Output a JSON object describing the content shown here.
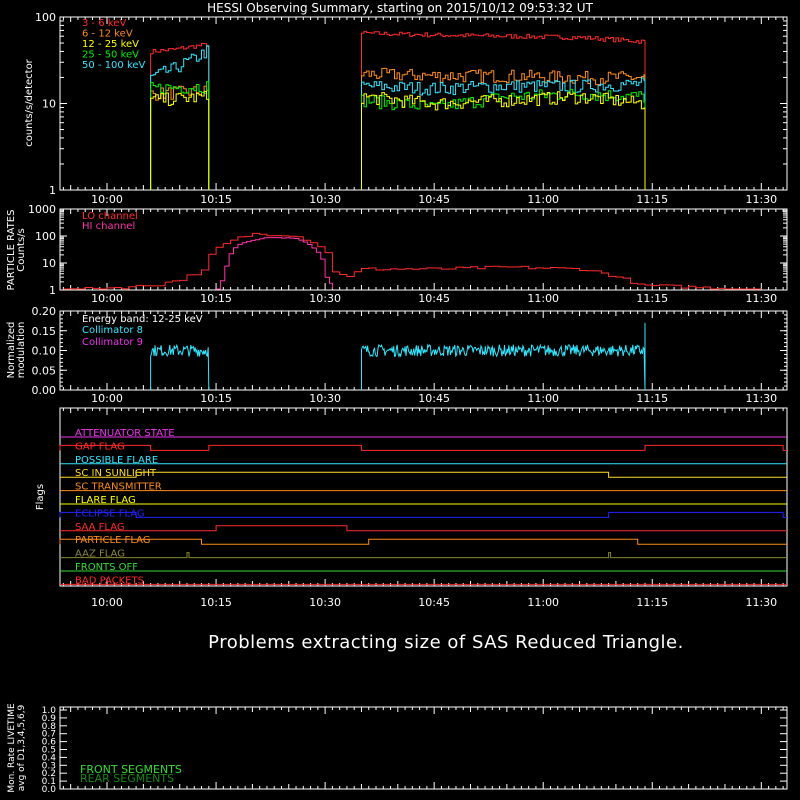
{
  "title": "HESSI Observing Summary, starting on 2015/10/12 09:53:32 UT",
  "message": "Problems extracting size of SAS Reduced Triangle.",
  "time_ticks": [
    "10:00",
    "10:15",
    "10:30",
    "10:45",
    "11:00",
    "11:15",
    "11:30"
  ],
  "colors": {
    "background": "#000000",
    "axes": "#ffffff",
    "band_3_6": "#ff2a2a",
    "band_6_12": "#ff8c1a",
    "band_12_25": "#ffff00",
    "band_25_50": "#00ee00",
    "band_50_100": "#33e6ff",
    "lo_channel": "#ff2a2a",
    "hi_channel": "#ff33aa",
    "collimator_8": "#33e6ff",
    "collimator_9": "#ee33ee",
    "front_segments": "#33dd33",
    "rear_segments": "#118811"
  },
  "chart_data": [
    {
      "type": "line",
      "panel": "count rates",
      "ylabel": "counts/s/detector",
      "yscale": "log",
      "ylim": [
        1,
        100
      ],
      "ytick_labels": [
        "1",
        "10",
        "100"
      ],
      "xlim": [
        "09:53:32",
        "11:33:32"
      ],
      "series": [
        {
          "name": "3 - 6 keV",
          "segments": [
            {
              "x": [
                "10:06",
                "10:09",
                "10:12",
                "10:14"
              ],
              "y": [
                40,
                42,
                46,
                48
              ]
            },
            {
              "x": [
                "10:35",
                "10:45",
                "10:55",
                "11:05",
                "11:14"
              ],
              "y": [
                65,
                62,
                60,
                58,
                52
              ]
            }
          ]
        },
        {
          "name": "6 - 12 keV",
          "segments": [
            {
              "x": [
                "10:06",
                "10:14"
              ],
              "y": [
                13,
                14
              ]
            },
            {
              "x": [
                "10:35",
                "10:45",
                "10:55",
                "11:05",
                "11:14"
              ],
              "y": [
                22,
                21,
                21,
                20,
                20
              ]
            }
          ]
        },
        {
          "name": "12 - 25 keV",
          "segments": [
            {
              "x": [
                "10:06",
                "10:14"
              ],
              "y": [
                11,
                12
              ]
            },
            {
              "x": [
                "10:35",
                "10:45",
                "10:55",
                "11:05",
                "11:14"
              ],
              "y": [
                12,
                10,
                11,
                12,
                10
              ]
            }
          ]
        },
        {
          "name": "25 - 50 keV",
          "segments": [
            {
              "x": [
                "10:06",
                "10:14"
              ],
              "y": [
                15,
                16
              ]
            },
            {
              "x": [
                "10:35",
                "10:45",
                "10:55",
                "11:05",
                "11:14"
              ],
              "y": [
                11,
                9,
                12,
                13,
                12
              ]
            }
          ]
        },
        {
          "name": "50 - 100 keV",
          "segments": [
            {
              "x": [
                "10:06",
                "10:09",
                "10:12",
                "10:14"
              ],
              "y": [
                20,
                25,
                33,
                42
              ]
            },
            {
              "x": [
                "10:35",
                "10:45",
                "10:55",
                "11:05",
                "11:14"
              ],
              "y": [
                16,
                15,
                16,
                16,
                17
              ]
            }
          ]
        }
      ]
    },
    {
      "type": "line",
      "panel": "particle rates",
      "ylabel": "PARTICLE RATES Counts/s",
      "yscale": "log",
      "ylim": [
        1,
        1000
      ],
      "ytick_labels": [
        "1",
        "10",
        "100",
        "1000"
      ],
      "series": [
        {
          "name": "LO channel",
          "x": [
            "09:54",
            "10:03",
            "10:07",
            "10:10",
            "10:13",
            "10:16",
            "10:20",
            "10:25",
            "10:28",
            "10:31",
            "10:33",
            "10:35",
            "10:45",
            "10:55",
            "11:05",
            "11:10",
            "11:13",
            "11:30"
          ],
          "y": [
            1,
            1.3,
            1.6,
            2.5,
            5,
            50,
            120,
            110,
            60,
            5,
            3,
            6,
            6,
            7,
            6,
            3,
            1.5,
            1
          ]
        },
        {
          "name": "HI channel",
          "x": [
            "10:15",
            "10:16",
            "10:18",
            "10:22",
            "10:26",
            "10:28",
            "10:30",
            "10:31"
          ],
          "y": [
            1,
            3,
            50,
            90,
            80,
            40,
            3,
            1
          ]
        }
      ]
    },
    {
      "type": "line",
      "panel": "modulation",
      "ylabel": "Normalized modulation",
      "ylim": [
        0,
        0.2
      ],
      "ytick_labels": [
        "0.00",
        "0.05",
        "0.10",
        "0.15",
        "0.20"
      ],
      "legend_title": "Energy band: 12-25 keV",
      "series": [
        {
          "name": "Collimator 8",
          "segments": [
            {
              "x": [
                "10:06",
                "10:14"
              ],
              "y": [
                0.1,
                0.1
              ]
            },
            {
              "x": [
                "10:35",
                "11:14"
              ],
              "y": [
                0.1,
                0.1
              ]
            }
          ]
        },
        {
          "name": "Collimator 9",
          "segments": []
        }
      ]
    },
    {
      "type": "line",
      "panel": "flags",
      "ylabel": "Flags",
      "flags": [
        {
          "name": "ATTENUATOR STATE",
          "color": "#ee33ee",
          "high": []
        },
        {
          "name": "GAP FLAG",
          "color": "#ff2a2a",
          "high": [
            [
              "09:53",
              "10:06"
            ],
            [
              "10:14",
              "10:35"
            ],
            [
              "11:14",
              "11:33"
            ]
          ]
        },
        {
          "name": "POSSIBLE FLARE",
          "color": "#33e6ff",
          "high": []
        },
        {
          "name": "SC IN SUNLIGHT",
          "color": "#ffdd22",
          "high": [
            [
              "10:04",
              "11:09"
            ]
          ]
        },
        {
          "name": "SC TRANSMITTER",
          "color": "#ff8c1a",
          "high": []
        },
        {
          "name": "FLARE FLAG",
          "color": "#ffff00",
          "high": []
        },
        {
          "name": "ECLIPSE FLAG",
          "color": "#2222ff",
          "high": [
            [
              "09:53",
              "10:04"
            ],
            [
              "11:09",
              "11:33"
            ]
          ]
        },
        {
          "name": "SAA FLAG",
          "color": "#ff2a2a",
          "high": [
            [
              "10:15",
              "10:33"
            ]
          ]
        },
        {
          "name": "PARTICLE FLAG",
          "color": "#ff8c1a",
          "high": [
            [
              "09:53",
              "10:13"
            ],
            [
              "10:36",
              "11:13"
            ]
          ]
        },
        {
          "name": "AAZ FLAG",
          "color": "#888833",
          "high": [
            [
              "10:11",
              "10:11"
            ],
            [
              "11:09",
              "11:09"
            ]
          ]
        },
        {
          "name": "FRONTS OFF",
          "color": "#33dd33",
          "high": []
        },
        {
          "name": "BAD PACKETS",
          "color": "#ff2a2a",
          "high": []
        }
      ]
    },
    {
      "type": "line",
      "panel": "livetime",
      "ylabel": "Mon. Rate LIVETIME avg of D1,3,4,5,6,9",
      "ylim": [
        0,
        1
      ],
      "ytick_labels": [
        "0.0",
        "0.1",
        "0.2",
        "0.3",
        "0.4",
        "0.5",
        "0.6",
        "0.7",
        "0.8",
        "0.9",
        "1.0"
      ],
      "series": [
        {
          "name": "FRONT SEGMENTS",
          "x": [],
          "y": []
        },
        {
          "name": "REAR SEGMENTS",
          "x": [],
          "y": []
        }
      ]
    }
  ]
}
